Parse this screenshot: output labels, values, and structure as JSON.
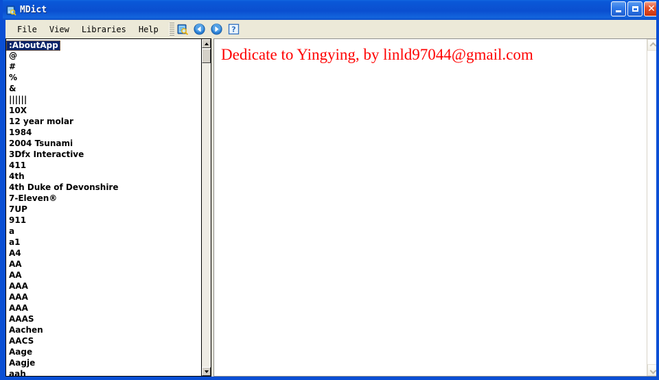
{
  "window": {
    "title": "MDict",
    "icon": "dictionary-book-icon",
    "caption_buttons": [
      {
        "name": "minimize",
        "label": "_"
      },
      {
        "name": "maximize",
        "label": "□"
      },
      {
        "name": "close",
        "label": "✕"
      }
    ]
  },
  "menubar": {
    "items": [
      {
        "label": "File"
      },
      {
        "label": "View"
      },
      {
        "label": "Libraries"
      },
      {
        "label": "Help"
      }
    ]
  },
  "toolbar": {
    "buttons": [
      {
        "name": "search-dictionary-icon",
        "tooltip": "Search"
      },
      {
        "name": "back-arrow-icon",
        "tooltip": "Back"
      },
      {
        "name": "forward-arrow-icon",
        "tooltip": "Forward"
      },
      {
        "name": "help-question-icon",
        "tooltip": "Help"
      }
    ]
  },
  "wordlist": {
    "selected": ":AboutApp",
    "items": [
      ":AboutApp",
      "@",
      "#",
      "%",
      "&",
      "||||||",
      "10X",
      "12 year molar",
      "1984",
      "2004 Tsunami",
      "3Dfx Interactive",
      "411",
      "4th",
      "4th Duke of Devonshire",
      "7-Eleven®",
      "7UP",
      "911",
      "a",
      "a1",
      "A4",
      "AA",
      "AA",
      "AAA",
      "AAA",
      "AAA",
      "AAAS",
      "Aachen",
      "AACS",
      "Aage",
      "Aagje",
      "aah"
    ]
  },
  "content": {
    "dedication": "Dedicate to Yingying, by linld97044@gmail.com",
    "text_color": "#ff0000"
  },
  "colors": {
    "titlebar_blue": "#0a4fd4",
    "menubar_beige": "#ece9d8",
    "selection_blue": "#0a246a",
    "focus_outline": "#e8a33d"
  }
}
